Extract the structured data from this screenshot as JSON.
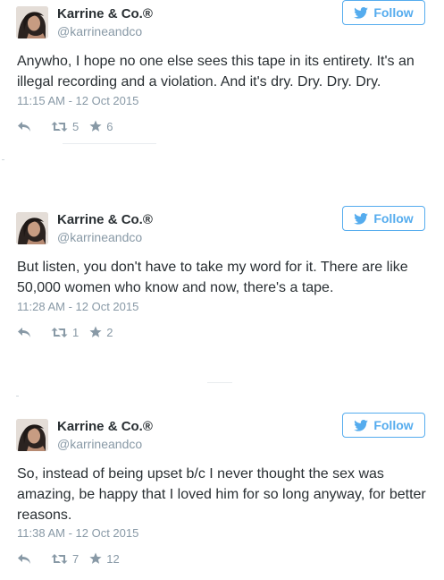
{
  "tweets": [
    {
      "author": {
        "name": "Karrine & Co.®",
        "handle": "@karrineandco"
      },
      "follow_label": "Follow",
      "text": "Anywho, I hope no one else sees this tape in its entirety. It's an illegal recording and a violation. And it's dry. Dry. Dry. Dry.",
      "timestamp": "11:15 AM - 12 Oct 2015",
      "retweets": "5",
      "favorites": "6"
    },
    {
      "author": {
        "name": "Karrine & Co.®",
        "handle": "@karrineandco"
      },
      "follow_label": "Follow",
      "text": "But listen, you don't have to take my word for it. There are like 50,000 women who know and now, there's a tape.",
      "timestamp": "11:28 AM - 12 Oct 2015",
      "retweets": "1",
      "favorites": "2"
    },
    {
      "author": {
        "name": "Karrine & Co.®",
        "handle": "@karrineandco"
      },
      "follow_label": "Follow",
      "text": "So, instead of being upset b/c I never thought the sex was amazing, be happy that I loved him for so long anyway, for better reasons.",
      "timestamp": "11:38 AM - 12 Oct 2015",
      "retweets": "7",
      "favorites": "12"
    }
  ],
  "icons": {
    "follow": "bird-icon",
    "reply": "reply-arrow-icon",
    "retweet": "retweet-icon",
    "favorite": "star-icon"
  },
  "colors": {
    "accent": "#55acee",
    "text": "#292f33",
    "meta": "#8899a6"
  }
}
